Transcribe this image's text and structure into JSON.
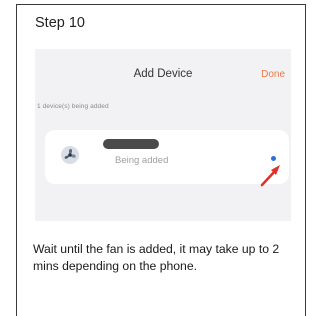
{
  "step": {
    "title": "Step 10"
  },
  "screen": {
    "header_title": "Add Device",
    "header_action": "Done",
    "subtitle": "1 device(s) being added",
    "device": {
      "status": "Being added",
      "avatar_icon": "fan-device-icon",
      "progress_icon": "loading-dot-icon"
    },
    "pointer_icon": "red-arrow-icon"
  },
  "instruction": "Wait until the fan is added, it may take up to 2 mins depending on the phone.",
  "colors": {
    "accent_done": "#ef7a4a",
    "progress_dot": "#2f6fd6",
    "arrow": "#e0322b"
  }
}
